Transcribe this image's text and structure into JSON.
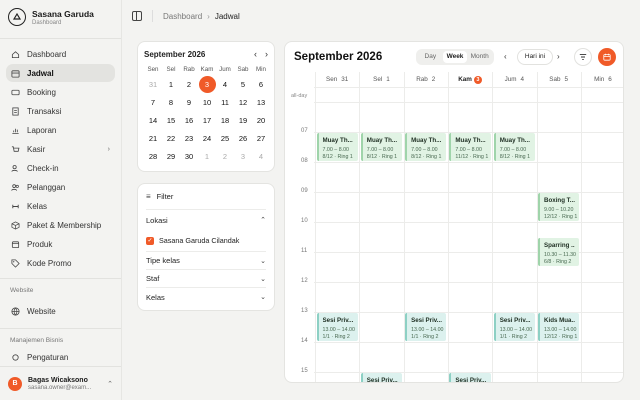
{
  "sidebar": {
    "brand_name": "Sasana Garuda",
    "brand_sub": "Dashboard",
    "items": [
      {
        "label": "Dashboard",
        "icon": "home-icon"
      },
      {
        "label": "Jadwal",
        "icon": "calendar-icon",
        "active": true
      },
      {
        "label": "Booking",
        "icon": "ticket-icon"
      },
      {
        "label": "Transaksi",
        "icon": "receipt-icon"
      },
      {
        "label": "Laporan",
        "icon": "chart-icon"
      },
      {
        "label": "Kasir",
        "icon": "cart-icon",
        "has_chevron": true
      },
      {
        "label": "Check-in",
        "icon": "user-check-icon"
      },
      {
        "label": "Pelanggan",
        "icon": "users-icon"
      },
      {
        "label": "Kelas",
        "icon": "dumbbell-icon"
      },
      {
        "label": "Paket & Membership",
        "icon": "package-icon"
      },
      {
        "label": "Produk",
        "icon": "box-icon"
      },
      {
        "label": "Kode Promo",
        "icon": "tag-icon"
      }
    ],
    "section_website": "Website",
    "website_item": "Website",
    "section_bisnis": "Manajemen Bisnis",
    "bisnis_item": "Pengaturan",
    "user": {
      "initial": "B",
      "name": "Bagas Wicaksono",
      "email": "sasana.owner@exam..."
    }
  },
  "breadcrumb": {
    "parent": "Dashboard",
    "current": "Jadwal"
  },
  "mini_calendar": {
    "month": "September 2026",
    "day_names": [
      "Sen",
      "Sel",
      "Rab",
      "Kam",
      "Jum",
      "Sab",
      "Min"
    ],
    "weeks": [
      [
        "31",
        "1",
        "2",
        "3",
        "4",
        "5",
        "6"
      ],
      [
        "7",
        "8",
        "9",
        "10",
        "11",
        "12",
        "13"
      ],
      [
        "14",
        "15",
        "16",
        "17",
        "18",
        "19",
        "20"
      ],
      [
        "21",
        "22",
        "23",
        "24",
        "25",
        "26",
        "27"
      ],
      [
        "28",
        "29",
        "30",
        "1",
        "2",
        "3",
        "4"
      ]
    ],
    "today": "3"
  },
  "filter": {
    "title": "Filter",
    "lokasi_label": "Lokasi",
    "lokasi_option": "Sasana Garuda Cilandak",
    "tipe_kelas": "Tipe kelas",
    "staf": "Staf",
    "kelas": "Kelas"
  },
  "calendar": {
    "title": "September 2026",
    "views": [
      "Day",
      "Week",
      "Month"
    ],
    "active_view": "Week",
    "today_button": "Hari ini",
    "all_day_label": "all-day",
    "days": [
      {
        "name": "Sen",
        "num": "31"
      },
      {
        "name": "Sel",
        "num": "1"
      },
      {
        "name": "Rab",
        "num": "2"
      },
      {
        "name": "Kam",
        "num": "3",
        "today": true
      },
      {
        "name": "Jum",
        "num": "4"
      },
      {
        "name": "Sab",
        "num": "5"
      },
      {
        "name": "Min",
        "num": "6"
      }
    ],
    "hours": [
      "07",
      "08",
      "09",
      "10",
      "11",
      "12",
      "13",
      "14",
      "15"
    ],
    "events": [
      {
        "day": 0,
        "start": 7,
        "end": 8,
        "title": "Muay Th...",
        "time": "7.00 – 8.00",
        "info": "8/12 · Ring 1",
        "color": "green"
      },
      {
        "day": 1,
        "start": 7,
        "end": 8,
        "title": "Muay Th...",
        "time": "7.00 – 8.00",
        "info": "8/12 · Ring 1",
        "color": "green"
      },
      {
        "day": 2,
        "start": 7,
        "end": 8,
        "title": "Muay Th...",
        "time": "7.00 – 8.00",
        "info": "8/12 · Ring 1",
        "color": "green"
      },
      {
        "day": 3,
        "start": 7,
        "end": 8,
        "title": "Muay Th...",
        "time": "7.00 – 8.00",
        "info": "11/12 · Ring 1",
        "color": "green"
      },
      {
        "day": 4,
        "start": 7,
        "end": 8,
        "title": "Muay Th...",
        "time": "7.00 – 8.00",
        "info": "8/12 · Ring 1",
        "color": "green"
      },
      {
        "day": 5,
        "start": 9,
        "end": 10,
        "title": "Boxing T...",
        "time": "9.00 – 10.20",
        "info": "12/12 · Ring 1",
        "color": "green"
      },
      {
        "day": 5,
        "start": 10.5,
        "end": 11.5,
        "title": "Sparring ...",
        "time": "10.30 – 11.30",
        "info": "6/8 · Ring 2",
        "color": "green"
      },
      {
        "day": 0,
        "start": 13,
        "end": 14,
        "title": "Sesi Priv...",
        "time": "13.00 – 14.00",
        "info": "1/1 · Ring 2",
        "color": "teal"
      },
      {
        "day": 2,
        "start": 13,
        "end": 14,
        "title": "Sesi Priv...",
        "time": "13.00 – 14.00",
        "info": "1/1 · Ring 2",
        "color": "teal"
      },
      {
        "day": 4,
        "start": 13,
        "end": 14,
        "title": "Sesi Priv...",
        "time": "13.00 – 14.00",
        "info": "1/1 · Ring 2",
        "color": "teal"
      },
      {
        "day": 5,
        "start": 13,
        "end": 14,
        "title": "Kids Mua...",
        "time": "13.00 – 14.00",
        "info": "12/12 · Ring 1",
        "color": "teal"
      },
      {
        "day": 1,
        "start": 15,
        "end": 16,
        "title": "Sesi Priv...",
        "time": "",
        "info": "",
        "color": "teal"
      },
      {
        "day": 3,
        "start": 15,
        "end": 16,
        "title": "Sesi Priv...",
        "time": "",
        "info": "",
        "color": "teal"
      }
    ]
  },
  "colors": {
    "accent": "#f05a28",
    "event_green": "#e1f3e4",
    "event_teal": "#dcf1ee"
  }
}
